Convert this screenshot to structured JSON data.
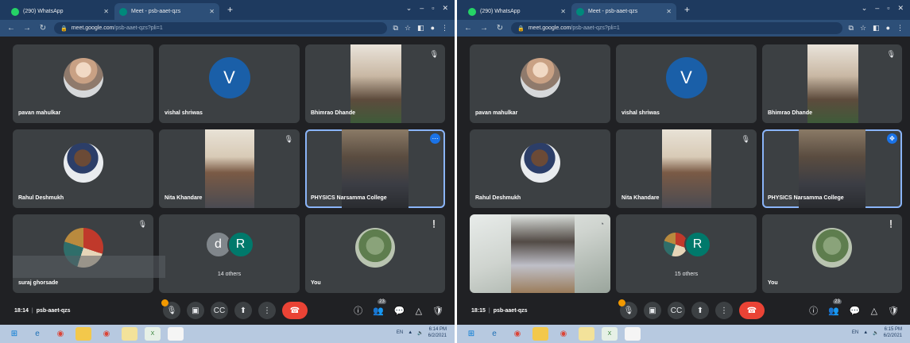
{
  "browser": {
    "tabs": [
      {
        "title": "(290) WhatsApp",
        "active": false
      },
      {
        "title": "Meet - psb-aaet-qzs",
        "active": true
      }
    ],
    "new_tab": "+",
    "url_host": "meet.google.com",
    "url_path": "/psb-aaet-qzs?pli=1"
  },
  "screens": [
    {
      "participants": [
        {
          "name": "pavan mahulkar"
        },
        {
          "name": "vishal shriwas",
          "initial": "V"
        },
        {
          "name": "Bhimrao Dhande"
        },
        {
          "name": "Rahul Deshmukh"
        },
        {
          "name": "Nita Khandare"
        },
        {
          "name": "PHYSICS Narsamma College"
        },
        {
          "name": "suraj ghorsade"
        },
        {
          "others_label": "14 others",
          "others_initials": [
            "d",
            "R"
          ]
        },
        {
          "name": "You"
        }
      ],
      "time": "18:14",
      "meeting_code": "psb-aaet-qzs",
      "participants_badge": "23",
      "clock": {
        "time": "6:14 PM",
        "date": "6/2/2021"
      }
    },
    {
      "participants": [
        {
          "name": "pavan mahulkar"
        },
        {
          "name": "vishal shriwas",
          "initial": "V"
        },
        {
          "name": "Bhimrao Dhande"
        },
        {
          "name": "Rahul Deshmukh"
        },
        {
          "name": "Nita Khandare"
        },
        {
          "name": "PHYSICS Narsamma College"
        },
        {
          "name": ""
        },
        {
          "others_label": "15 others",
          "others_initials": [
            "R"
          ]
        },
        {
          "name": "You"
        }
      ],
      "time": "18:15",
      "meeting_code": "psb-aaet-qzs",
      "participants_badge": "23",
      "clock": {
        "time": "6:15 PM",
        "date": "6/2/2021"
      }
    }
  ],
  "tray_lang": "EN",
  "colors": {
    "meet_bg": "#202124",
    "tile_bg": "#3c4043",
    "end_call": "#ea4335",
    "speaker_outline": "#8ab4f8",
    "avatar_v": "#1a5fa8"
  },
  "icons": [
    "mic-icon",
    "camera-icon",
    "captions-icon",
    "present-icon",
    "more-icon",
    "end-call-icon",
    "info-icon",
    "people-icon",
    "chat-icon",
    "activities-icon",
    "host-controls-icon"
  ]
}
